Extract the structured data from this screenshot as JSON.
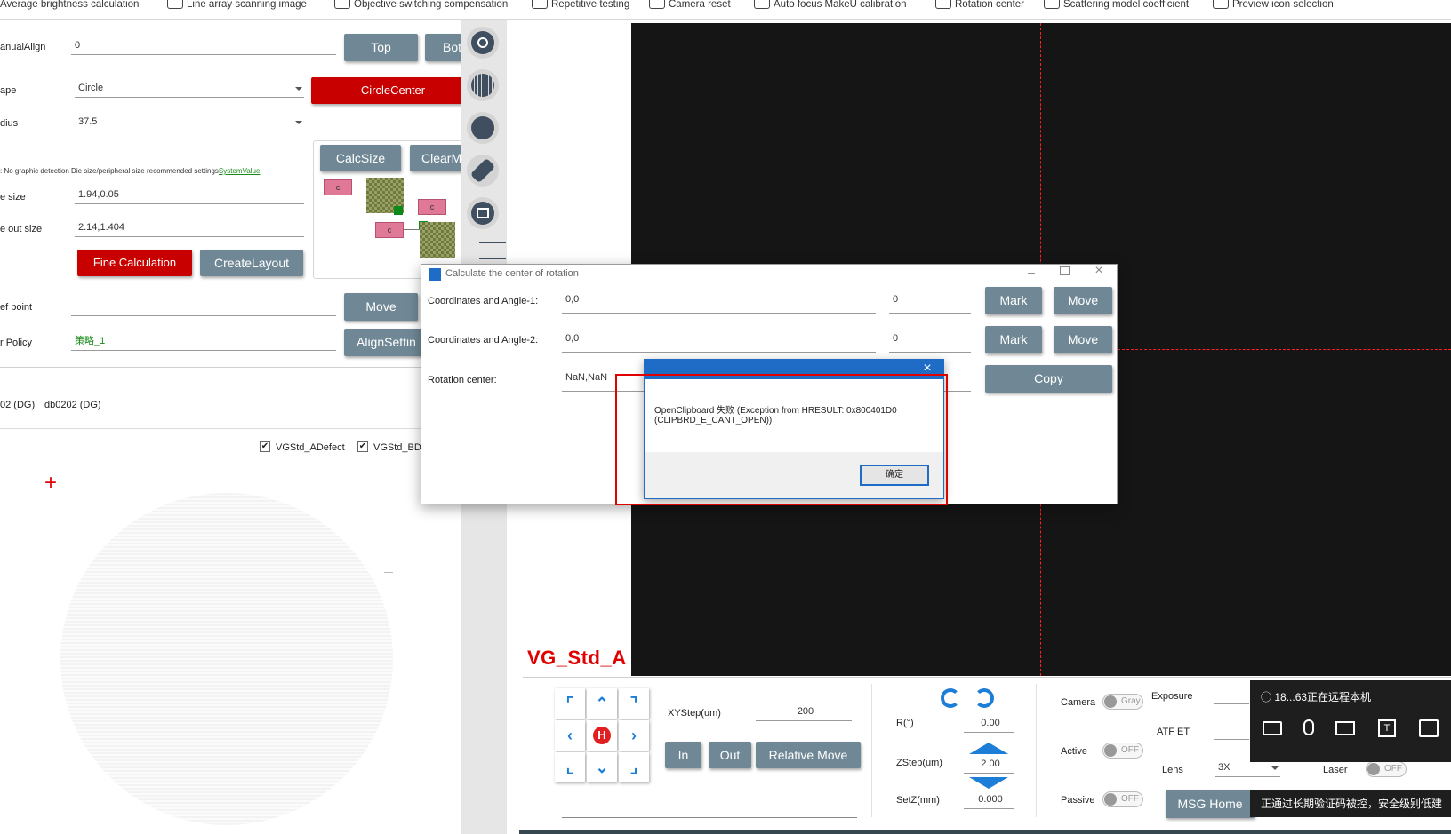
{
  "toolbar": {
    "items": [
      "Average brightness calculation",
      "Line array scanning image",
      "Objective switching compensation",
      "Repetitive testing",
      "Camera reset",
      "Auto focus MakeU calibration",
      "Rotation center",
      "Scattering model coefficient",
      "Preview icon selection"
    ]
  },
  "left": {
    "manual_align_label": "anualAlign",
    "manual_align_value": "0",
    "top_btn": "Top",
    "bottom_btn": "Botto",
    "shape_label": "ape",
    "shape_value": "Circle",
    "circle_center_btn": "CircleCenter",
    "radius_label": "dius",
    "radius_value": "37.5",
    "calc_size_btn": "CalcSize",
    "clear_mark_btn": "ClearMar",
    "hint_text": ": No graphic detection Die size/peripheral size recommended settings",
    "hint_link": "SystemValue",
    "die_size_label": "e size",
    "die_size_value": "1.94,0.05",
    "out_size_label": "e out size",
    "out_size_value": "2.14,1.404",
    "fine_calc_btn": "Fine Calculation",
    "create_layout_btn": "CreateLayout",
    "chip_label": "c",
    "ref_point_label": "ef point",
    "ref_point_value": "",
    "move_btn": "Move",
    "policy_label": "r Policy",
    "policy_value": "策略_1",
    "align_setting_btn": "AlignSettin",
    "recipe_link_1": "02 (DG)",
    "recipe_link_2": "db0202 (DG)",
    "check_1": "VGStd_ADefect",
    "check_2": "VGStd_BD"
  },
  "view": {
    "title": "VG_Std_A"
  },
  "dialog": {
    "title": "Calculate the center of rotation",
    "row1_label": "Coordinates and Angle-1:",
    "row1_coord": "0,0",
    "row1_angle": "0",
    "row2_label": "Coordinates and Angle-2:",
    "row2_coord": "0,0",
    "row2_angle": "0",
    "row3_label": "Rotation center:",
    "row3_value": "NaN,NaN",
    "mark_btn": "Mark",
    "move_btn": "Move",
    "copy_btn": "Copy"
  },
  "msgbox": {
    "line1": "OpenClipboard 失败 (Exception from HRESULT: 0x800401D0",
    "line2": "(CLIPBRD_E_CANT_OPEN))",
    "ok_btn": "确定"
  },
  "bottom": {
    "xystep_label": "XYStep(um)",
    "xystep_value": "200",
    "in_btn": "In",
    "out_btn": "Out",
    "relative_move_btn": "Relative Move",
    "r_label": "R(°)",
    "r_value": "0.00",
    "zstep_label": "ZStep(um)",
    "zstep_value": "2.00",
    "setz_label": "SetZ(mm)",
    "setz_value": "0.000",
    "camera_label": "Camera",
    "camera_toggle": "Gray",
    "active_label": "Active",
    "active_toggle": "OFF",
    "passive_label": "Passive",
    "passive_toggle": "OFF",
    "exposure_label": "Exposure",
    "atf_label": "ATF ET",
    "lens_label": "Lens",
    "lens_value": "3X",
    "laser_label": "Laser",
    "laser_toggle": "OFF",
    "msg_home_btn": "MSG Home",
    "home_key": "H"
  },
  "remote": {
    "status": "18...63正在远程本机",
    "toast": "正通过长期验证码被控，安全级别低建"
  }
}
